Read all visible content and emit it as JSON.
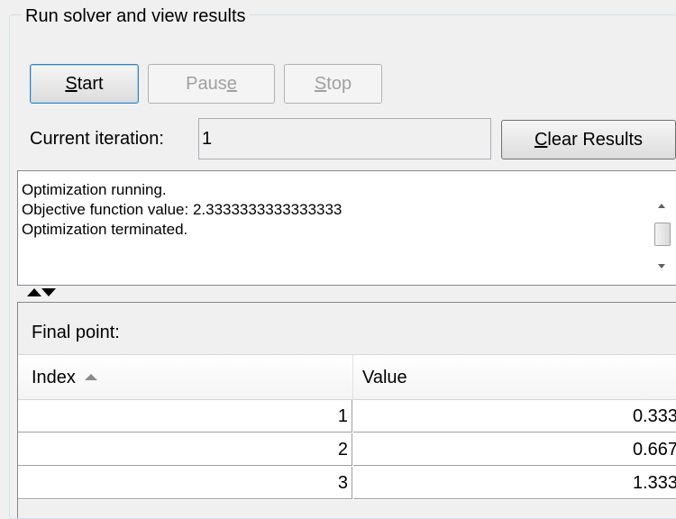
{
  "panel": {
    "title": "Run solver and view results"
  },
  "buttons": {
    "start": {
      "mnemonic": "S",
      "rest": "tart"
    },
    "pause": {
      "pre": "Paus",
      "mnemonic": "e",
      "rest": ""
    },
    "stop": {
      "mnemonic": "S",
      "rest": "top"
    },
    "clear": {
      "mnemonic": "C",
      "rest": "lear Results"
    }
  },
  "iteration": {
    "label": "Current iteration:",
    "value": "1"
  },
  "log": {
    "lines": [
      "Optimization running.",
      "Objective function value: 2.3333333333333333",
      "Optimization terminated."
    ]
  },
  "results": {
    "title": "Final point:",
    "columns": [
      "Index",
      "Value"
    ],
    "rows": [
      {
        "index": "1",
        "value": "0.333"
      },
      {
        "index": "2",
        "value": "0.667"
      },
      {
        "index": "3",
        "value": "1.333"
      }
    ]
  },
  "colors": {
    "window_bg": "#f0f0f0",
    "primary_button_border": "#3c7fb1",
    "disabled_text": "#a0a0a0"
  }
}
